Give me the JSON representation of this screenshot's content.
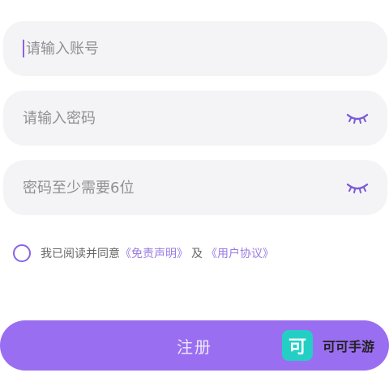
{
  "form": {
    "account": {
      "placeholder": "请输入账号",
      "value": ""
    },
    "password": {
      "placeholder": "请输入密码",
      "value": ""
    },
    "confirm": {
      "placeholder": "密码至少需要6位",
      "value": ""
    }
  },
  "agreement": {
    "prefix": "我已阅读并同意",
    "disclaimer": "《免责声明》",
    "and": "及",
    "user_agreement": "《用户协议》",
    "checked": false
  },
  "submit_label": "注册",
  "watermark": {
    "logo_text": "可",
    "name": "可可手游"
  },
  "colors": {
    "accent": "#9a6ef0",
    "field_bg": "#f4f4f6",
    "link": "#9a7be2",
    "watermark_bg": "#23cfc4"
  },
  "icons": {
    "visibility": "eye-closed-icon",
    "checkbox": "radio-icon"
  }
}
